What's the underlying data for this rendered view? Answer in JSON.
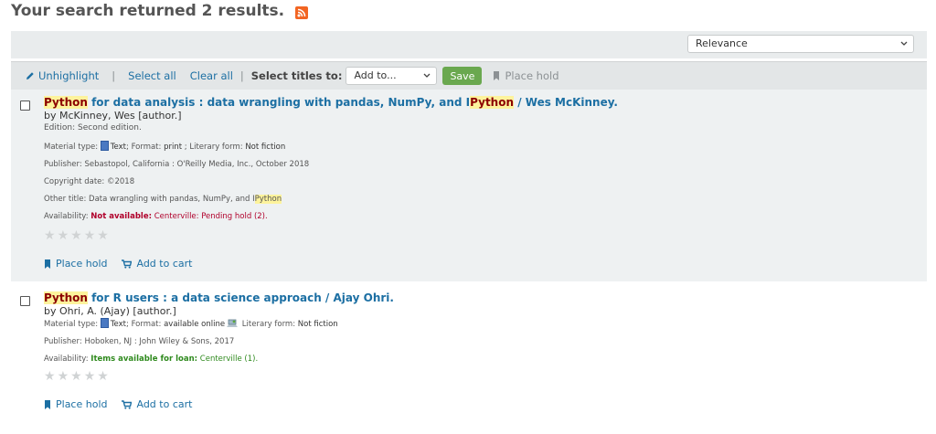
{
  "heading": {
    "text": "Your search returned 2 results."
  },
  "sort": {
    "selected": "Relevance"
  },
  "toolbar": {
    "unhighlight": "Unhighlight",
    "select_all": "Select all",
    "clear_all": "Clear all",
    "select_titles": "Select titles to:",
    "add_to": "Add to...",
    "save": "Save",
    "place_hold": "Place hold",
    "sep": "|"
  },
  "results": [
    {
      "title_hl1": "Python",
      "title_mid": " for data analysis : data wrangling with pandas, NumPy, and I",
      "title_hl2": "Python",
      "title_end": " / Wes McKinney.",
      "author": "by McKinney, Wes [author.]",
      "edition": "Edition: Second edition.",
      "material_label": "Material type: ",
      "material_value": "Text",
      "format_label": "; Format: ",
      "format_value": "print",
      "literary_label": " ; Literary form: ",
      "literary_value": "Not fiction",
      "publisher": "Publisher: Sebastopol, California : O'Reilly Media, Inc., October 2018",
      "copyright": "Copyright date: ©2018",
      "other_title_prefix": "Other title: Data wrangling with pandas, NumPy, and I",
      "other_title_hl": "Python",
      "availability_label": "Availability: ",
      "availability_status": "Not available:",
      "availability_detail": " Centerville: Pending hold (2).",
      "place_hold": "Place hold",
      "add_to_cart": "Add to cart"
    },
    {
      "title_hl1": "Python",
      "title_mid": " for R users : a data science approach / Ajay Ohri.",
      "author": "by Ohri, A. (Ajay) [author.]",
      "material_label": "Material type: ",
      "material_value": "Text",
      "format_label": "; Format: ",
      "format_value": "available online",
      "literary_label": " Literary form: ",
      "literary_value": "Not fiction",
      "publisher": "Publisher: Hoboken, NJ : John Wiley & Sons, 2017",
      "availability_label": "Availability: ",
      "availability_status": "Items available for loan:",
      "availability_detail": " Centerville (1).",
      "place_hold": "Place hold",
      "add_to_cart": "Add to cart"
    }
  ],
  "colors": {
    "link": "#1c6fa3",
    "save_button": "#6aa84f",
    "not_available": "#b0002b",
    "available": "#2f8a1e",
    "highlight": "#fdf39c",
    "rss": "#f26522"
  },
  "icons": [
    "rss-icon",
    "pencil-icon",
    "chevron-down-icon",
    "bookmark-icon",
    "cart-icon",
    "book-icon",
    "online-icon",
    "star-icon"
  ],
  "ratings": [
    0,
    0
  ]
}
